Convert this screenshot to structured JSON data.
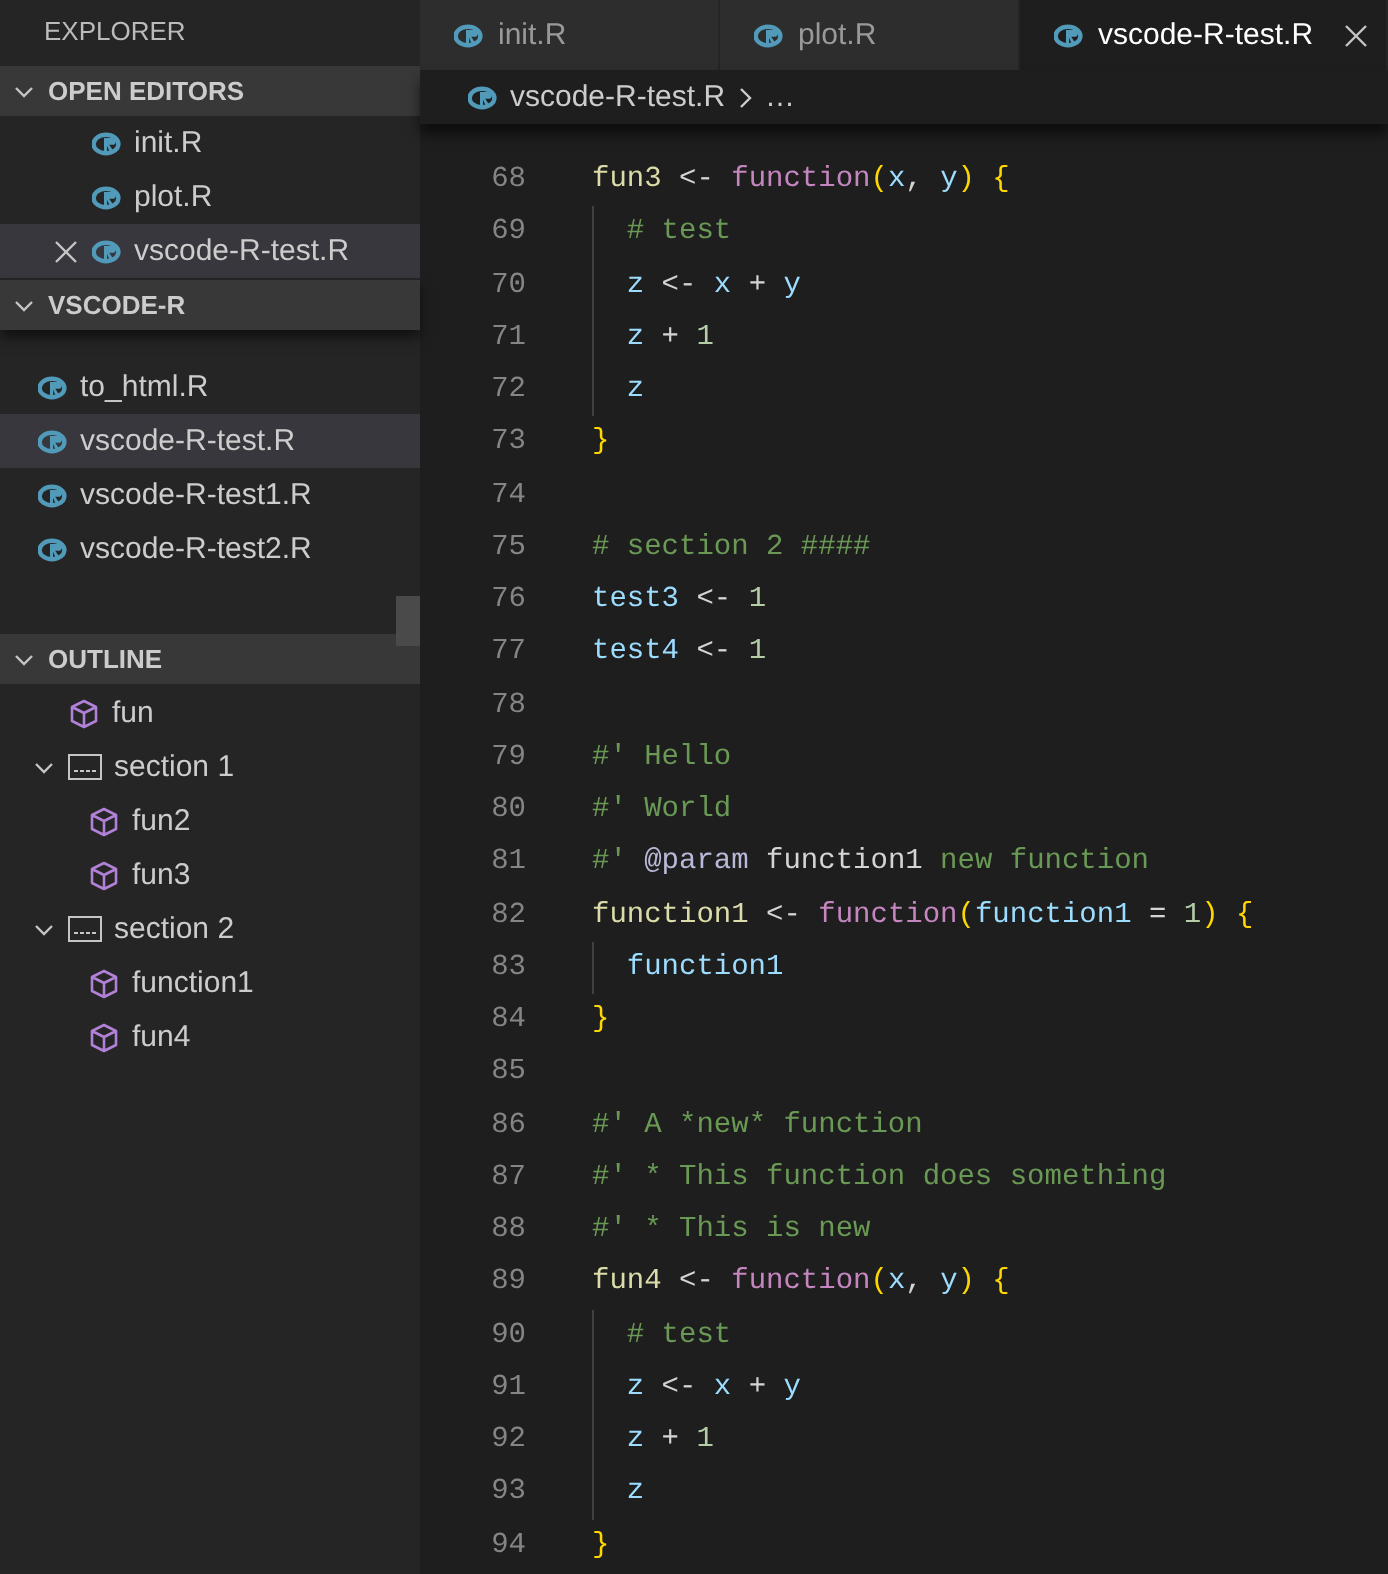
{
  "sidebar": {
    "title": "EXPLORER",
    "open_editors": {
      "title": "OPEN EDITORS",
      "expanded": true,
      "items": [
        {
          "label": "init.R",
          "selected": false
        },
        {
          "label": "plot.R",
          "selected": false
        },
        {
          "label": "vscode-R-test.R",
          "selected": true
        }
      ]
    },
    "folder": {
      "title": "VSCODE-R",
      "expanded": true,
      "items": [
        {
          "label": "to_html.R",
          "selected": false
        },
        {
          "label": "vscode-R-test.R",
          "selected": true
        },
        {
          "label": "vscode-R-test1.R",
          "selected": false
        },
        {
          "label": "vscode-R-test2.R",
          "selected": false
        }
      ]
    },
    "outline": {
      "title": "OUTLINE",
      "expanded": true,
      "items": [
        {
          "label": "fun",
          "kind": "function"
        },
        {
          "label": "section 1",
          "kind": "section",
          "expanded": true,
          "children": [
            {
              "label": "fun2",
              "kind": "function"
            },
            {
              "label": "fun3",
              "kind": "function"
            }
          ]
        },
        {
          "label": "section 2",
          "kind": "section",
          "expanded": true,
          "children": [
            {
              "label": "function1",
              "kind": "function"
            },
            {
              "label": "fun4",
              "kind": "function"
            }
          ]
        }
      ]
    }
  },
  "editor": {
    "tabs": [
      {
        "label": "init.R",
        "selected": false
      },
      {
        "label": "plot.R",
        "selected": false
      },
      {
        "label": "vscode-R-test.R",
        "selected": true
      }
    ],
    "breadcrumb": {
      "file": "vscode-R-test.R",
      "more": "…"
    },
    "lines": [
      {
        "number": "68",
        "code": "fun3 <- function(x, y) {",
        "children": [
          {
            "number": "69",
            "code": "# test"
          },
          {
            "number": "70",
            "code": "z <- x + y"
          },
          {
            "number": "71",
            "code": "z + 1"
          },
          {
            "number": "72",
            "code": "z"
          }
        ]
      },
      {
        "number": "73",
        "code": "}"
      },
      {
        "number": "74"
      },
      {
        "number": "75",
        "code": "# section 2 ####"
      },
      {
        "number": "76",
        "code": "test3 <- 1"
      },
      {
        "number": "77",
        "code": "test4 <- 1"
      },
      {
        "number": "78"
      },
      {
        "number": "79",
        "code": "#' Hello"
      },
      {
        "number": "80",
        "code": "#' World"
      },
      {
        "number": "81",
        "code": "#' @param function1 new function"
      },
      {
        "number": "82",
        "code": "function1 <- function(function1 = 1) {",
        "children": [
          {
            "number": "83",
            "code": "function1"
          }
        ]
      },
      {
        "number": "84",
        "code": "}"
      },
      {
        "number": "85"
      },
      {
        "number": "86",
        "code": "#' A *new* function"
      },
      {
        "number": "87",
        "code": "#' * This function does something"
      },
      {
        "number": "88",
        "code": "#' * This is new"
      },
      {
        "number": "89",
        "code": "fun4 <- function(x, y) {",
        "children": [
          {
            "number": "90",
            "code": "# test"
          },
          {
            "number": "91",
            "code": "z <- x + y"
          },
          {
            "number": "92",
            "code": "z + 1"
          },
          {
            "number": "93",
            "code": "z"
          }
        ]
      },
      {
        "number": "94",
        "code": "}"
      }
    ]
  }
}
